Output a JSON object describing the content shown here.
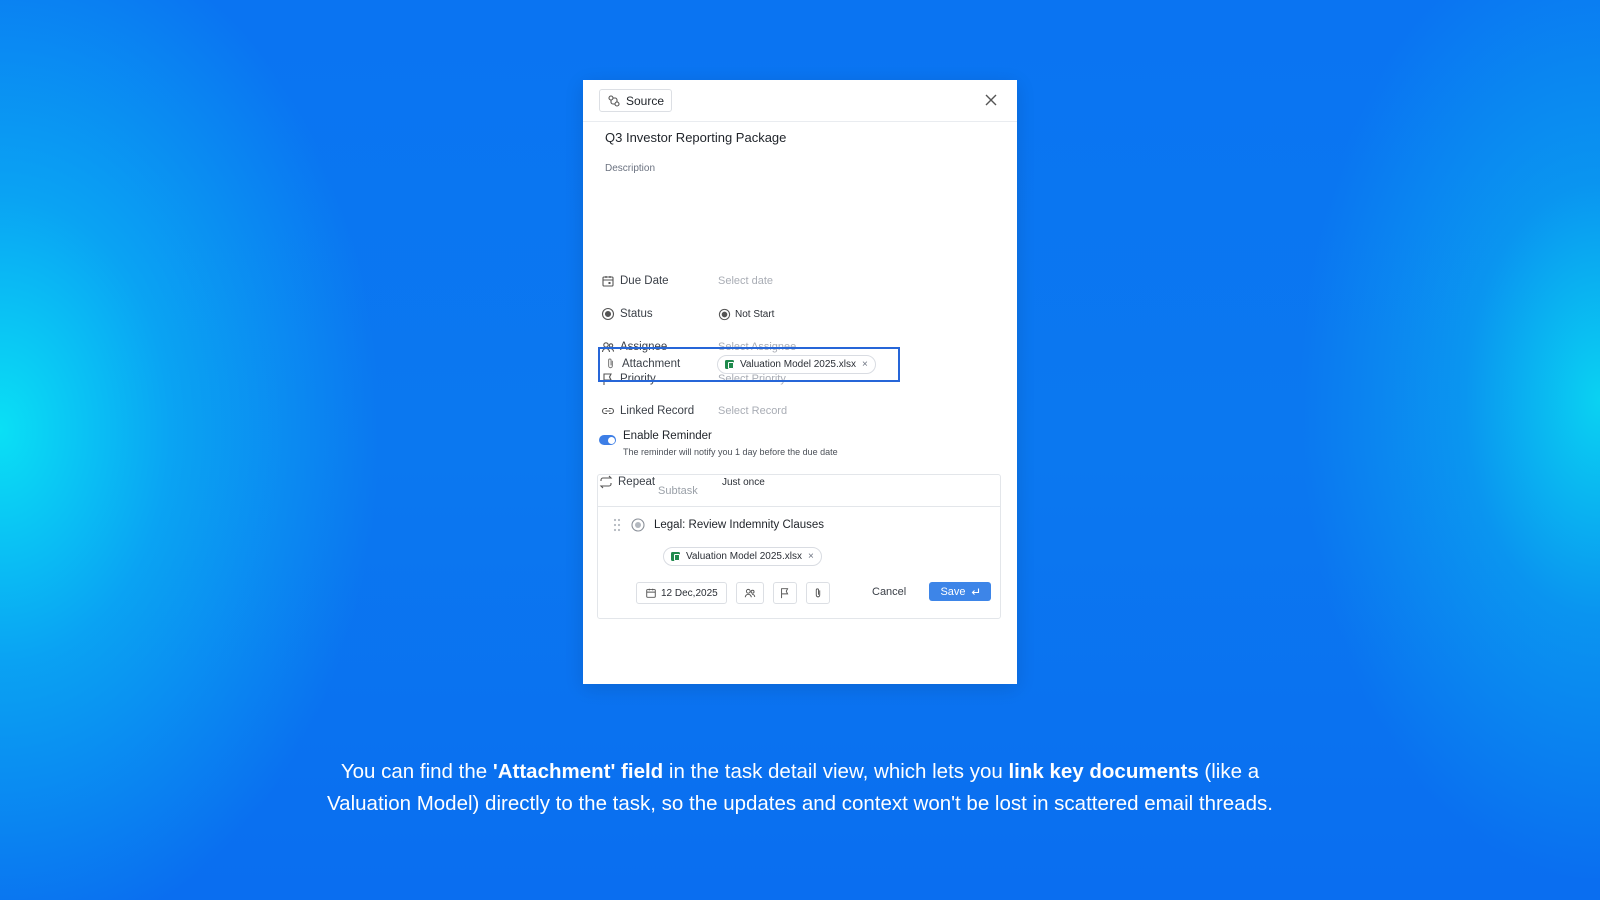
{
  "modal": {
    "source_label": "Source",
    "title": "Q3 Investor Reporting Package",
    "description_label": "Description",
    "fields": {
      "due_date": {
        "label": "Due Date",
        "value": "Select date"
      },
      "status": {
        "label": "Status",
        "value": "Not Start"
      },
      "assignee": {
        "label": "Assignee",
        "value": "Select Assignee"
      },
      "priority": {
        "label": "Priority",
        "value": "Select Priority"
      },
      "linked_record": {
        "label": "Linked Record",
        "value": "Select Record"
      },
      "attachment": {
        "label": "Attachment",
        "file": "Valuation Model 2025.xlsx"
      },
      "repeat": {
        "label": "Repeat",
        "value": "Just once"
      }
    },
    "reminder": {
      "title": "Enable Reminder",
      "subtitle": "The reminder will notify you 1 day before the due date",
      "enabled": true
    },
    "subtask": {
      "placeholder": "Subtask",
      "item_text": "Legal: Review Indemnity Clauses",
      "file": "Valuation Model 2025.xlsx",
      "date": "12 Dec,2025",
      "cancel_label": "Cancel",
      "save_label": "Save"
    }
  },
  "caption": {
    "line1_a": "You can find the ",
    "line1_b": "'Attachment' field",
    "line1_c": " in the task detail view, which lets you ",
    "line1_d": "link key documents",
    "line1_e": " (like a",
    "line2": "Valuation Model) directly to the task, so the updates and context won't be lost in scattered email threads."
  },
  "colors": {
    "accent": "#3d85e8",
    "highlight_border": "#2666d8",
    "excel_green": "#1f8a4c"
  }
}
